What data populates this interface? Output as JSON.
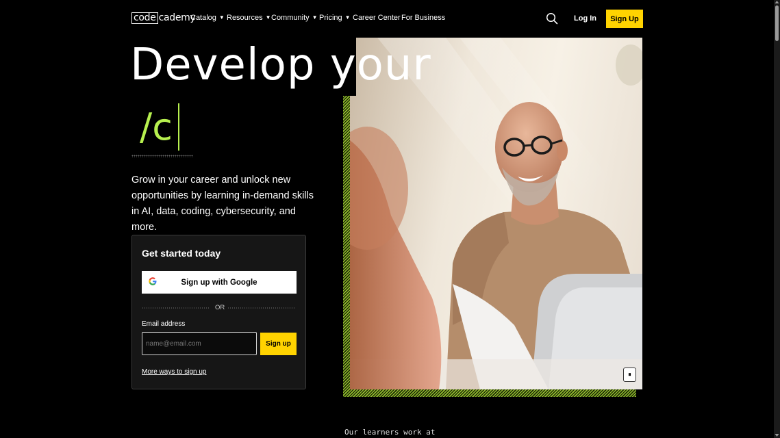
{
  "nav": {
    "logo_code": "code",
    "logo_rest": "cademy",
    "items": [
      {
        "label": "Catalog",
        "caret": "▼"
      },
      {
        "label": "Resources",
        "caret": "▼"
      },
      {
        "label": "Community",
        "caret": "▼"
      },
      {
        "label": "Pricing",
        "caret": "▼"
      },
      {
        "label": "Career Center"
      },
      {
        "label": "For Business"
      }
    ],
    "login_label": "Log In",
    "signup_label": "Sign Up",
    "search_icon": "search-icon"
  },
  "hero": {
    "headline": "Develop your",
    "typed_text": "/c",
    "subcopy": "Grow in your career and unlock new opportunities by learning in-demand skills in AI, data, coding, cybersecurity, and more.",
    "pause_icon": "pause-icon",
    "pause_glyph": "⏸"
  },
  "signup_card": {
    "title": "Get started today",
    "google_label": "Sign up with Google",
    "or_label": "OR",
    "email_label": "Email address",
    "email_placeholder": "name@email.com",
    "email_value": "",
    "submit_label": "Sign up",
    "more_ways_label": "More ways to sign up"
  },
  "learners": {
    "heading": "Our learners work at"
  },
  "colors": {
    "accent_yellow": "#ffd300",
    "accent_green": "#b7f04f",
    "background": "#000000"
  }
}
